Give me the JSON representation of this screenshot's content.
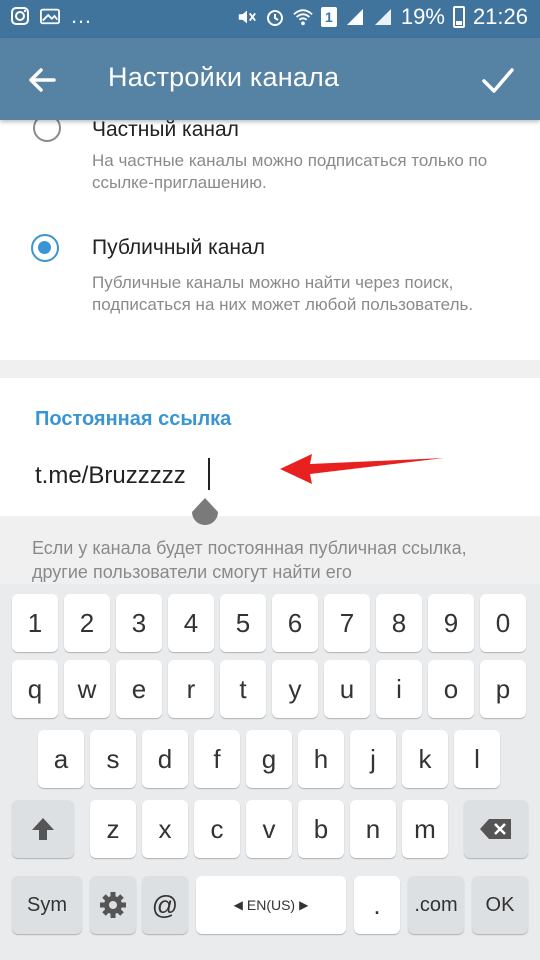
{
  "status_bar": {
    "battery_percent": "19%",
    "time": "21:26",
    "sim_label": "1",
    "left_icons": [
      "instagram-icon",
      "gallery-icon",
      "more-dots-icon"
    ],
    "right_icons": [
      "mute-icon",
      "alarm-icon",
      "wifi-icon",
      "sim-icon",
      "signal-icon",
      "signal-icon",
      "battery-icon"
    ]
  },
  "app_bar": {
    "title": "Настройки канала",
    "back_icon": "arrow-back-icon",
    "done_icon": "checkmark-icon",
    "background": "#5682a3"
  },
  "channel_type": {
    "private": {
      "title": "Частный канал",
      "description": "На частные каналы можно подписаться только по ссылке-приглашению.",
      "selected": false
    },
    "public": {
      "title": "Публичный канал",
      "description": "Публичные каналы можно найти через поиск, подписаться на них может любой пользователь.",
      "selected": true
    }
  },
  "permanent_link": {
    "header": "Постоянная ссылка",
    "value": "t.me/Bruzzzzz",
    "accent_color": "#3a95d5"
  },
  "info_text": "Если у канала будет постоянная публичная ссылка, другие пользователи смогут найти его",
  "keyboard": {
    "row_numbers": [
      "1",
      "2",
      "3",
      "4",
      "5",
      "6",
      "7",
      "8",
      "9",
      "0"
    ],
    "row_qwerty": [
      "q",
      "w",
      "e",
      "r",
      "t",
      "y",
      "u",
      "i",
      "o",
      "p"
    ],
    "row_asdf": [
      "a",
      "s",
      "d",
      "f",
      "g",
      "h",
      "j",
      "k",
      "l"
    ],
    "row_zxcv": [
      "z",
      "x",
      "c",
      "v",
      "b",
      "n",
      "m"
    ],
    "sym_label": "Sym",
    "at_label": "@",
    "space_label": "EN(US)",
    "period_label": ".",
    "dotcom_label": ".com",
    "ok_label": "OK"
  },
  "annotation": {
    "arrow_color": "#e82020"
  }
}
